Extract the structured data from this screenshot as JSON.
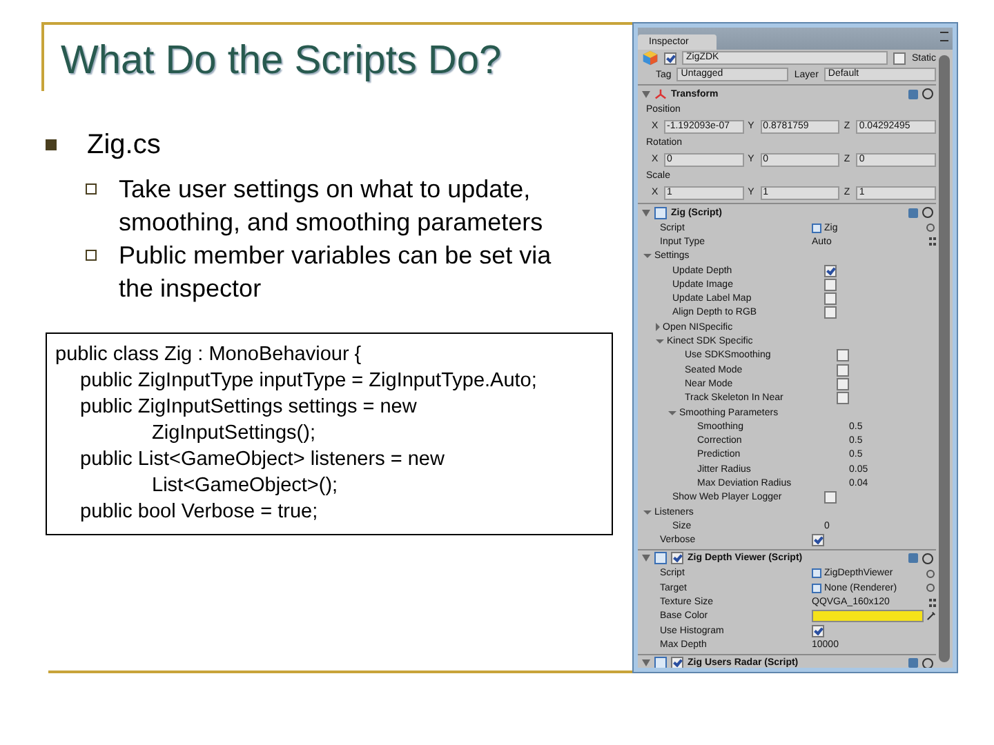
{
  "slide": {
    "title": "What Do the Scripts Do?",
    "bullets": [
      {
        "text": "Zig.cs",
        "children": [
          {
            "text": "Take user settings on what to update, smoothing, and smoothing parameters"
          },
          {
            "text": "Public member variables can be set via the inspector"
          }
        ]
      }
    ],
    "code": {
      "lines": [
        {
          "text": "public class Zig : MonoBehaviour {",
          "children": [
            {
              "text": "public ZigInputType inputType = ZigInputType.Auto;"
            },
            {
              "text": "public ZigInputSettings settings = new",
              "children": [
                {
                  "text": "ZigInputSettings();"
                }
              ]
            },
            {
              "text": "public List<GameObject> listeners = new",
              "children": [
                {
                  "text": "List<GameObject>();"
                }
              ]
            },
            {
              "text": "public bool Verbose = true;"
            }
          ]
        }
      ]
    }
  },
  "inspector": {
    "tab": "Inspector",
    "object": {
      "active": true,
      "name": "ZigZDK",
      "static_label": "Static",
      "static": false,
      "tag_label": "Tag",
      "tag": "Untagged",
      "layer_label": "Layer",
      "layer": "Default"
    },
    "components": [
      {
        "title": "Transform",
        "kind": "transform",
        "expanded": true,
        "rows": [
          {
            "kind": "vector",
            "label": "Position",
            "fields": [
              {
                "axis": "X",
                "value": "-1.192093e-07"
              },
              {
                "axis": "Y",
                "value": "0.8781759"
              },
              {
                "axis": "Z",
                "value": "0.04292495"
              }
            ]
          },
          {
            "kind": "vector",
            "label": "Rotation",
            "fields": [
              {
                "axis": "X",
                "value": "0"
              },
              {
                "axis": "Y",
                "value": "0"
              },
              {
                "axis": "Z",
                "value": "0"
              }
            ]
          },
          {
            "kind": "vector",
            "label": "Scale",
            "fields": [
              {
                "axis": "X",
                "value": "1"
              },
              {
                "axis": "Y",
                "value": "1"
              },
              {
                "axis": "Z",
                "value": "1"
              }
            ]
          }
        ]
      },
      {
        "title": "Zig (Script)",
        "kind": "script",
        "expanded": true,
        "rows": [
          {
            "kind": "object",
            "label": "Script",
            "value": "Zig"
          },
          {
            "kind": "enum",
            "label": "Input Type",
            "value": "Auto"
          },
          {
            "kind": "foldout",
            "label": "Settings",
            "expanded": true,
            "children": [
              {
                "kind": "check",
                "label": "Update Depth",
                "checked": true
              },
              {
                "kind": "check",
                "label": "Update Image",
                "checked": false
              },
              {
                "kind": "check",
                "label": "Update Label Map",
                "checked": false
              },
              {
                "kind": "check",
                "label": "Align Depth to RGB",
                "checked": false
              },
              {
                "kind": "foldout",
                "label": "Open NISpecific",
                "expanded": false
              },
              {
                "kind": "foldout",
                "label": "Kinect SDK Specific",
                "expanded": true,
                "children": [
                  {
                    "kind": "check",
                    "label": "Use SDKSmoothing",
                    "checked": false
                  },
                  {
                    "kind": "check",
                    "label": "Seated Mode",
                    "checked": false
                  },
                  {
                    "kind": "check",
                    "label": "Near Mode",
                    "checked": false
                  },
                  {
                    "kind": "check",
                    "label": "Track Skeleton In Near",
                    "checked": false
                  },
                  {
                    "kind": "foldout",
                    "label": "Smoothing Parameters",
                    "expanded": true,
                    "children": [
                      {
                        "kind": "field",
                        "label": "Smoothing",
                        "value": "0.5"
                      },
                      {
                        "kind": "field",
                        "label": "Correction",
                        "value": "0.5"
                      },
                      {
                        "kind": "field",
                        "label": "Prediction",
                        "value": "0.5"
                      },
                      {
                        "kind": "field",
                        "label": "Jitter Radius",
                        "value": "0.05"
                      },
                      {
                        "kind": "field",
                        "label": "Max Deviation Radius",
                        "value": "0.04"
                      }
                    ]
                  }
                ]
              },
              {
                "kind": "check",
                "label": "Show Web Player Logger",
                "checked": false
              }
            ]
          },
          {
            "kind": "foldout",
            "label": "Listeners",
            "expanded": true,
            "children": [
              {
                "kind": "field",
                "label": "Size",
                "value": "0"
              }
            ]
          },
          {
            "kind": "check",
            "label": "Verbose",
            "checked": true
          }
        ]
      },
      {
        "title": "Zig Depth Viewer (Script)",
        "kind": "script",
        "enabled": true,
        "expanded": true,
        "rows": [
          {
            "kind": "object",
            "label": "Script",
            "value": "ZigDepthViewer"
          },
          {
            "kind": "object",
            "label": "Target",
            "value": "None (Renderer)"
          },
          {
            "kind": "enum",
            "label": "Texture Size",
            "value": "QQVGA_160x120"
          },
          {
            "kind": "color",
            "label": "Base Color",
            "color": "#f5e21a"
          },
          {
            "kind": "check",
            "label": "Use Histogram",
            "checked": true
          },
          {
            "kind": "field",
            "label": "Max Depth",
            "value": "10000"
          }
        ]
      },
      {
        "title": "Zig Users Radar (Script)",
        "kind": "script",
        "enabled": true,
        "expanded": true
      }
    ]
  }
}
